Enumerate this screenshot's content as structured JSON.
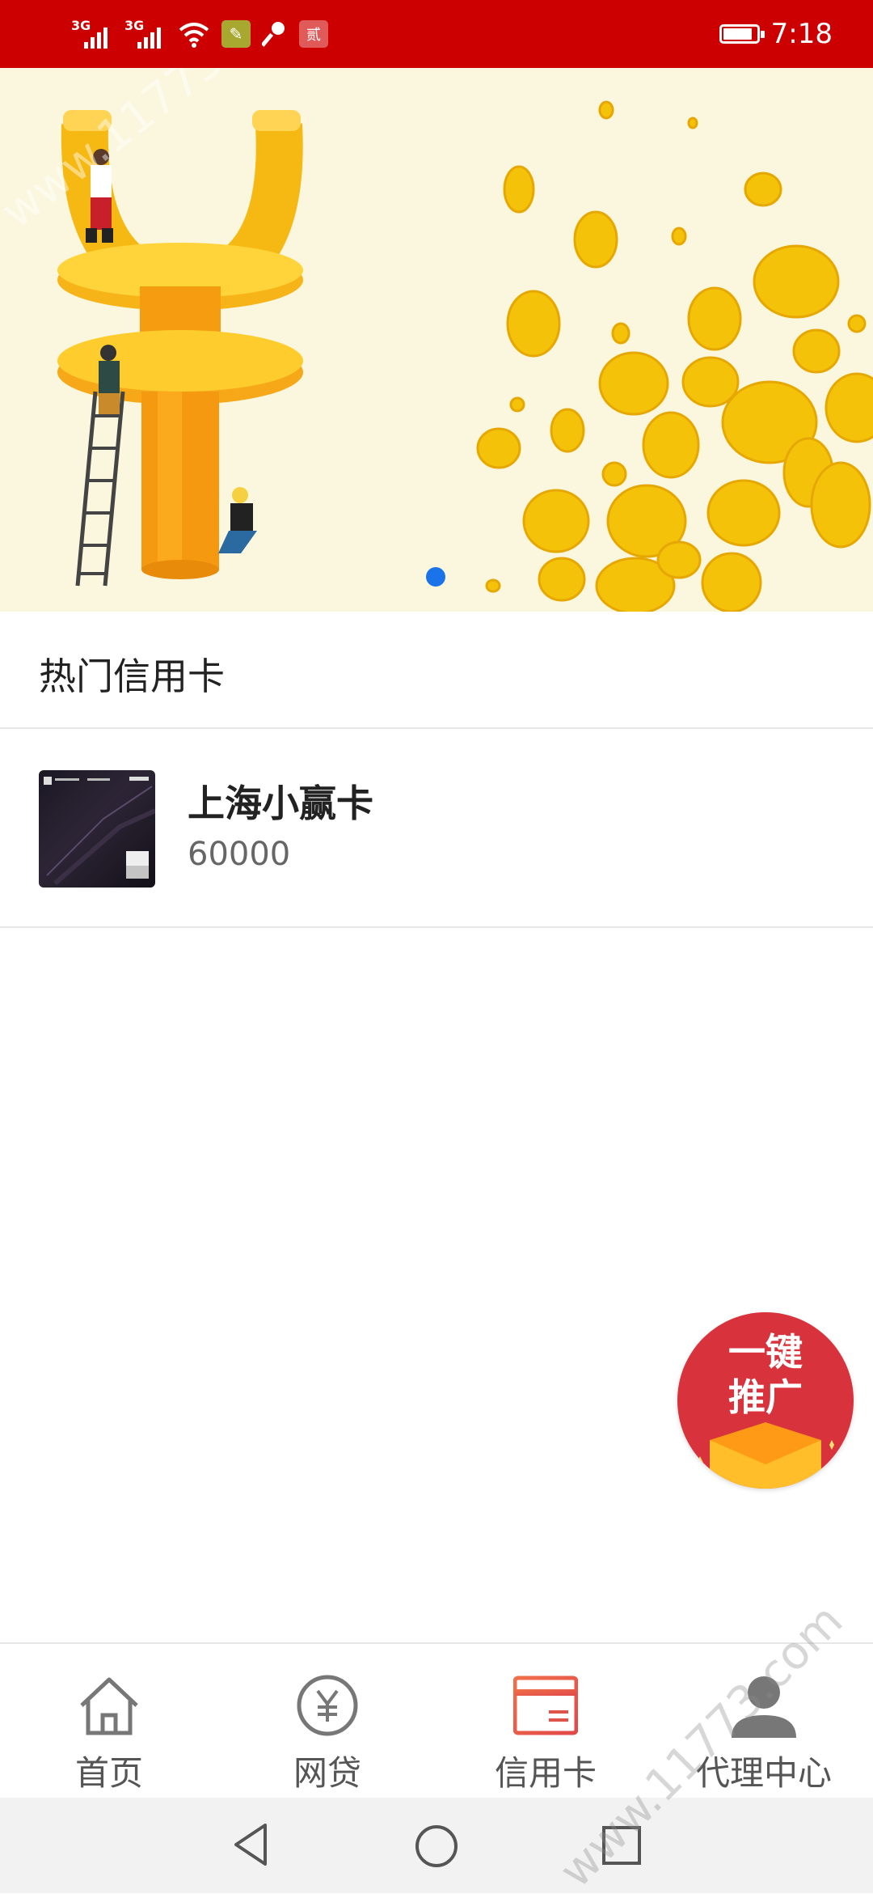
{
  "status_bar": {
    "sim1_label": "3G",
    "sim2_label": "3G",
    "app_badge": "贰",
    "time": "7:18",
    "battery_level": 0.9
  },
  "banner": {
    "active_slide": 1,
    "slide_count": 1
  },
  "section": {
    "title": "热门信用卡"
  },
  "cards": [
    {
      "name": "上海小赢卡",
      "limit": "60000"
    }
  ],
  "float_button": {
    "line1": "一键",
    "line2": "推广"
  },
  "bottom_nav": {
    "items": [
      {
        "label": "首页",
        "icon": "home-icon",
        "active": false
      },
      {
        "label": "网贷",
        "icon": "yuan-icon",
        "active": false
      },
      {
        "label": "信用卡",
        "icon": "credit-card-icon",
        "active": true
      },
      {
        "label": "代理中心",
        "icon": "user-icon",
        "active": false
      }
    ]
  },
  "watermark": "www.11773.com",
  "colors": {
    "status_bar": "#cc0000",
    "banner_bg": "#fbf7de",
    "accent_blue": "#1a73e8",
    "float_button": "#d8323c",
    "nav_active": "#e0534a"
  }
}
